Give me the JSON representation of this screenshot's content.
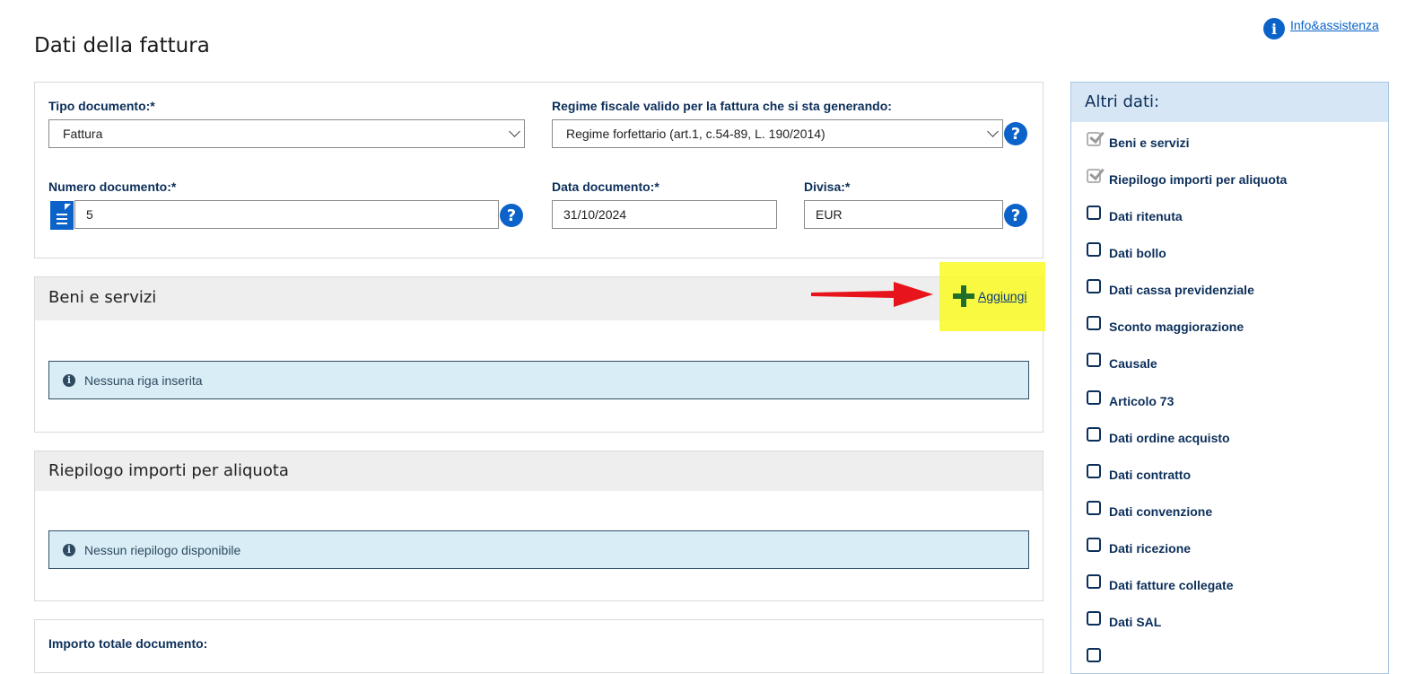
{
  "page": {
    "title": "Dati della fattura",
    "info_link": "Info&assistenza"
  },
  "form": {
    "tipo_documento": {
      "label": "Tipo documento:*",
      "value": "Fattura"
    },
    "regime_fiscale": {
      "label": "Regime fiscale valido per la fattura che si sta generando:",
      "value": "Regime forfettario (art.1, c.54-89, L. 190/2014)"
    },
    "numero_documento": {
      "label": "Numero documento:*",
      "value": "5"
    },
    "data_documento": {
      "label": "Data documento:*",
      "value": "31/10/2024"
    },
    "divisa": {
      "label": "Divisa:*",
      "value": "EUR"
    },
    "help_glyph": "?"
  },
  "beni_servizi": {
    "title": "Beni e servizi",
    "add_label": "Aggiungi",
    "empty_message": "Nessuna riga inserita"
  },
  "riepilogo": {
    "title": "Riepilogo importi per aliquota",
    "empty_message": "Nessun riepilogo disponibile"
  },
  "totale": {
    "label": "Importo totale documento:"
  },
  "sidebar": {
    "title": "Altri dati:",
    "items": [
      {
        "label": "Beni e servizi",
        "checked": true
      },
      {
        "label": "Riepilogo importi per aliquota",
        "checked": true
      },
      {
        "label": "Dati ritenuta",
        "checked": false
      },
      {
        "label": "Dati bollo",
        "checked": false
      },
      {
        "label": "Dati cassa previdenziale",
        "checked": false
      },
      {
        "label": "Sconto maggiorazione",
        "checked": false
      },
      {
        "label": "Causale",
        "checked": false
      },
      {
        "label": "Articolo 73",
        "checked": false
      },
      {
        "label": "Dati ordine acquisto",
        "checked": false
      },
      {
        "label": "Dati contratto",
        "checked": false
      },
      {
        "label": "Dati convenzione",
        "checked": false
      },
      {
        "label": "Dati ricezione",
        "checked": false
      },
      {
        "label": "Dati fatture collegate",
        "checked": false
      },
      {
        "label": "Dati SAL",
        "checked": false
      },
      {
        "label": "",
        "checked": false
      }
    ]
  },
  "colors": {
    "primary_blue": "#0b63c9",
    "label_navy": "#0c2f5a",
    "alert_bg": "#d9edf7",
    "highlight_yellow": "#fbfb2a",
    "arrow_red": "#e8141b",
    "add_green": "#1f6f2a"
  }
}
